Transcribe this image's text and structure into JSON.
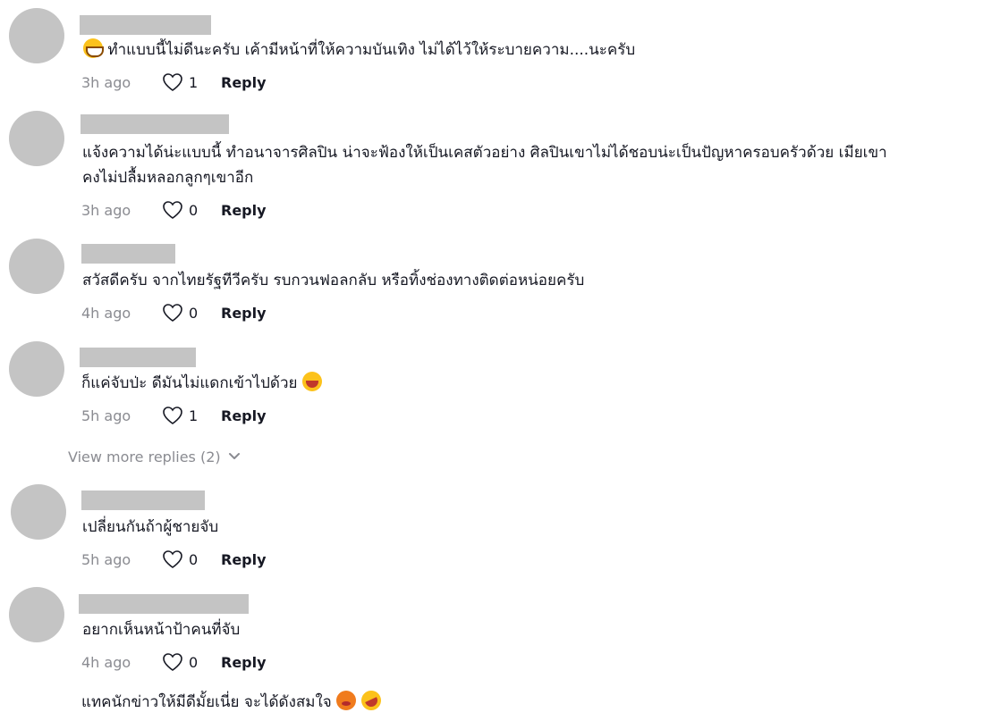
{
  "comments": [
    {
      "text": "ทำแบบนี้ไม่ดีนะครับ เค้ามีหน้าที่ให้ความบันเทิง ไม่ได้ไว้ให้ระบายความ....นะครับ",
      "lead_emoji": "grinning-face-emoji",
      "time": "3h ago",
      "likes": "1",
      "reply": "Reply"
    },
    {
      "text_line1": "แจ้งความได้น่ะแบบนี้ ทำอนาจารศิลปิน น่าจะฟ้องให้เป็นเคสตัวอย่าง ศิลปินเขาไม่ได้ชอบน่ะเป็นปัญหาครอบครัวด้วย เมียเขา",
      "text_line2": "คงไม่ปลื้มหลอกลูกๆเขาอีก",
      "time": "3h ago",
      "likes": "0",
      "reply": "Reply"
    },
    {
      "text": "สวัสดีครับ จากไทยรัฐทีวีครับ รบกวนฟอลกลับ หรือทิ้งช่องทางติดต่อหน่อยครับ",
      "time": "4h ago",
      "likes": "0",
      "reply": "Reply"
    },
    {
      "text": "ก็แค่จับป่ะ ดีมันไม่แดกเข้าไปด้วย",
      "trail_emoji": "laughing-face-emoji",
      "time": "5h ago",
      "likes": "1",
      "reply": "Reply"
    },
    {
      "text": "เปลี่ยนกันถ้าผู้ชายจับ",
      "time": "5h ago",
      "likes": "0",
      "reply": "Reply"
    },
    {
      "text": "อยากเห็นหน้าป้าคนที่จับ",
      "time": "4h ago",
      "likes": "0",
      "reply": "Reply"
    },
    {
      "text": "แทคนักข่าวให้มีดีมั้ยเนี่ย จะได้ดังสมใจ",
      "trail_emojis": [
        "hot-face-emoji",
        "rofl-emoji"
      ]
    }
  ],
  "view_more": {
    "label": "View more replies (2)",
    "icon": "chevron-down-icon"
  },
  "colors": {
    "avatar": "#c4c4c4",
    "muted": "#8a8b91",
    "text": "#161823"
  }
}
